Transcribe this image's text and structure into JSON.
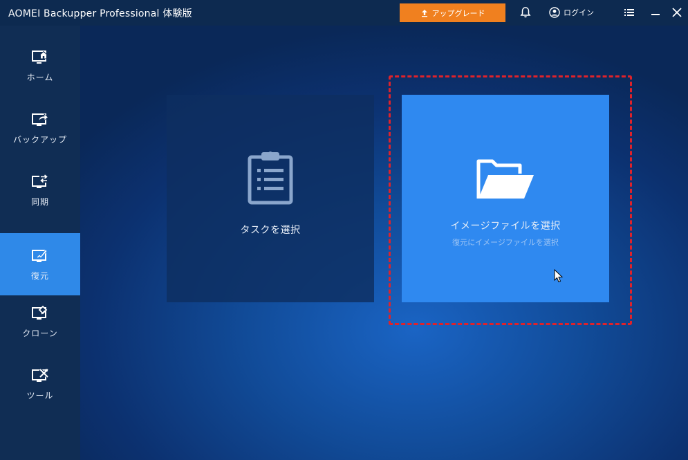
{
  "window": {
    "title": "AOMEI Backupper Professional 体験版"
  },
  "header": {
    "upgrade_label": "アップグレード",
    "login_label": "ログイン",
    "icons": [
      "upgrade-arrow-icon",
      "bell-icon",
      "user-icon",
      "menu-icon",
      "minimize-icon",
      "close-icon"
    ]
  },
  "sidebar": {
    "items": [
      {
        "label": "ホーム",
        "icon": "home-icon",
        "active": false
      },
      {
        "label": "バックアップ",
        "icon": "backup-icon",
        "active": false
      },
      {
        "label": "同期",
        "icon": "sync-icon",
        "active": false
      },
      {
        "label": "復元",
        "icon": "restore-icon",
        "active": true
      },
      {
        "label": "クローン",
        "icon": "clone-icon",
        "active": false
      },
      {
        "label": "ツール",
        "icon": "tools-icon",
        "active": false
      }
    ]
  },
  "main": {
    "task_card": {
      "title": "タスクを選択",
      "icon": "clipboard-list-icon"
    },
    "image_card": {
      "title": "イメージファイルを選択",
      "subtitle": "復元にイメージファイルを選択",
      "icon": "folder-open-icon"
    }
  },
  "colors": {
    "accent": "#2f89f0",
    "sidebar_active": "#2f89e8",
    "upgrade": "#f0801f",
    "highlight_border": "#e0222a"
  }
}
